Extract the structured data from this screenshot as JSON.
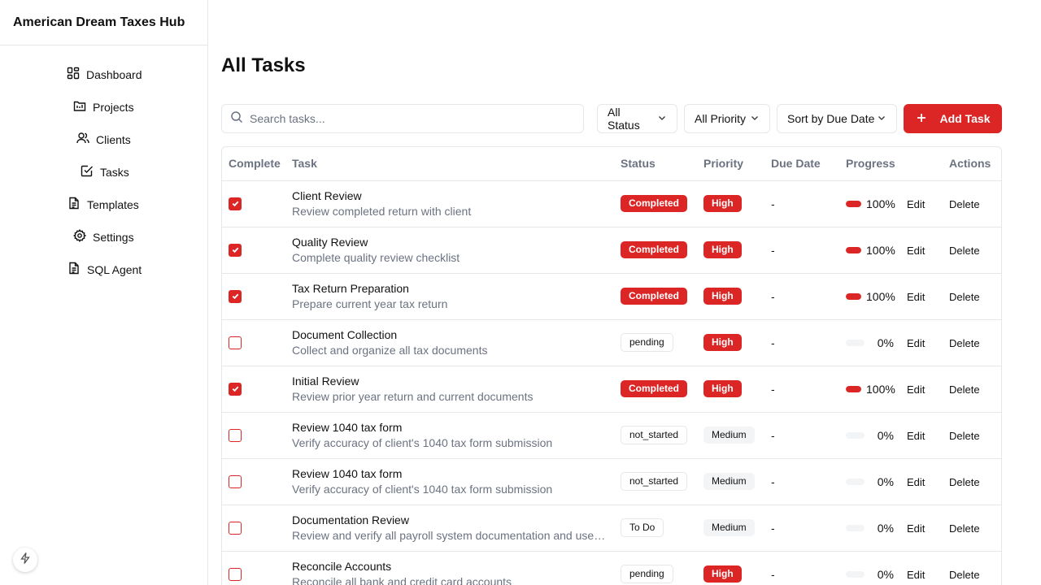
{
  "app": {
    "title": "American Dream Taxes Hub"
  },
  "sidebar": {
    "items": [
      {
        "label": "Dashboard",
        "icon": "dashboard-icon"
      },
      {
        "label": "Projects",
        "icon": "projects-icon"
      },
      {
        "label": "Clients",
        "icon": "clients-icon"
      },
      {
        "label": "Tasks",
        "icon": "tasks-icon"
      },
      {
        "label": "Templates",
        "icon": "templates-icon"
      },
      {
        "label": "Settings",
        "icon": "gear-icon"
      },
      {
        "label": "SQL Agent",
        "icon": "document-icon"
      }
    ]
  },
  "page": {
    "title": "All Tasks"
  },
  "toolbar": {
    "search_placeholder": "Search tasks...",
    "status_filter": "All Status",
    "priority_filter": "All Priority",
    "sort": "Sort by Due Date",
    "add_label": "Add Task"
  },
  "table": {
    "headers": {
      "complete": "Complete",
      "task": "Task",
      "status": "Status",
      "priority": "Priority",
      "due": "Due Date",
      "progress": "Progress",
      "actions": "Actions"
    },
    "edit_label": "Edit",
    "delete_label": "Delete",
    "rows": [
      {
        "complete": true,
        "title": "Client Review",
        "desc": "Review completed return with client",
        "status": "Completed",
        "priority": "High",
        "due": "-",
        "progress": 1.0,
        "progress_label": "100%"
      },
      {
        "complete": true,
        "title": "Quality Review",
        "desc": "Complete quality review checklist",
        "status": "Completed",
        "priority": "High",
        "due": "-",
        "progress": 1.0,
        "progress_label": "100%"
      },
      {
        "complete": true,
        "title": "Tax Return Preparation",
        "desc": "Prepare current year tax return",
        "status": "Completed",
        "priority": "High",
        "due": "-",
        "progress": 1.0,
        "progress_label": "100%"
      },
      {
        "complete": false,
        "title": "Document Collection",
        "desc": "Collect and organize all tax documents",
        "status": "pending",
        "priority": "High",
        "due": "-",
        "progress": 0,
        "progress_label": "0%"
      },
      {
        "complete": true,
        "title": "Initial Review",
        "desc": "Review prior year return and current documents",
        "status": "Completed",
        "priority": "High",
        "due": "-",
        "progress": 1.0,
        "progress_label": "100%"
      },
      {
        "complete": false,
        "title": "Review 1040 tax form",
        "desc": "Verify accuracy of client's 1040 tax form submission",
        "status": "not_started",
        "priority": "Medium",
        "due": "-",
        "progress": 0,
        "progress_label": "0%"
      },
      {
        "complete": false,
        "title": "Review 1040 tax form",
        "desc": "Verify accuracy of client's 1040 tax form submission",
        "status": "not_started",
        "priority": "Medium",
        "due": "-",
        "progress": 0,
        "progress_label": "0%"
      },
      {
        "complete": false,
        "title": "Documentation Review",
        "desc": "Review and verify all payroll system documentation and user guides",
        "status": "To Do",
        "priority": "Medium",
        "due": "-",
        "progress": 0,
        "progress_label": "0%"
      },
      {
        "complete": false,
        "title": "Reconcile Accounts",
        "desc": "Reconcile all bank and credit card accounts",
        "status": "pending",
        "priority": "High",
        "due": "-",
        "progress": 0,
        "progress_label": "0%"
      }
    ]
  },
  "colors": {
    "accent": "#dc2626",
    "border": "#e5e7eb",
    "muted": "#6b7280"
  }
}
